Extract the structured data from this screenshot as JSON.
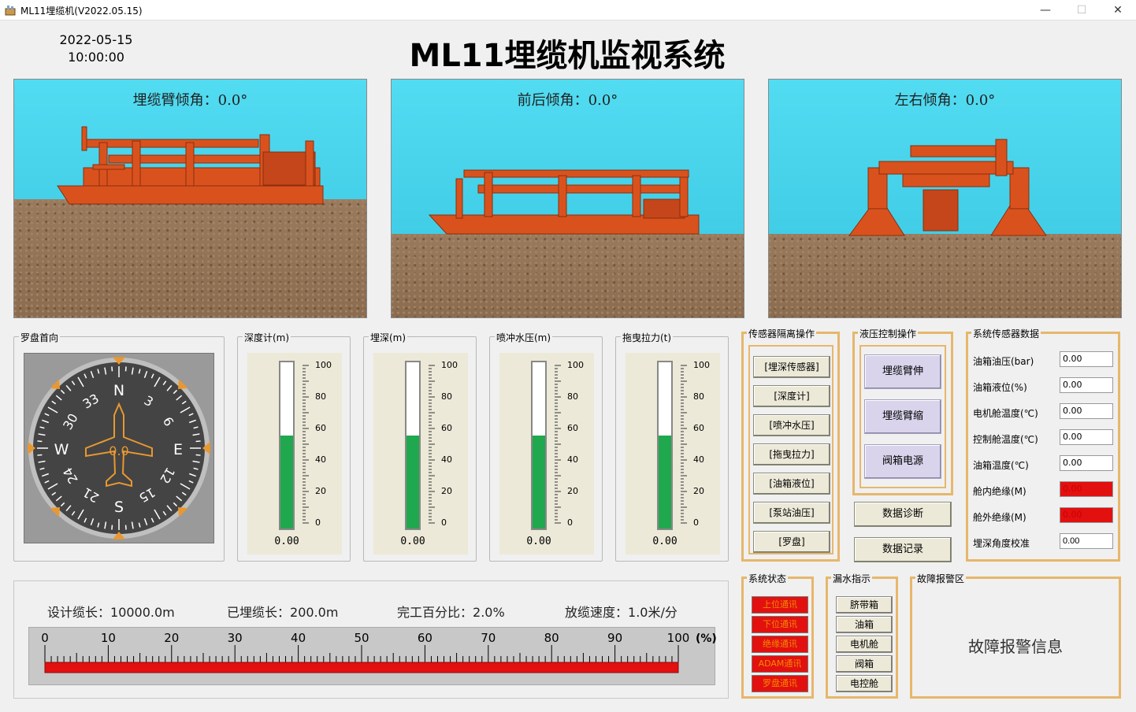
{
  "window": {
    "title": "ML11埋缆机(V2022.05.15)",
    "minimize": "—",
    "maximize": "☐",
    "close": "✕"
  },
  "header": {
    "date": "2022-05-15",
    "time": "10:00:00",
    "title": "ML11埋缆机监视系统"
  },
  "scenes": [
    {
      "label": "埋缆臂倾角：0.0°"
    },
    {
      "label": "前后倾角：0.0°"
    },
    {
      "label": "左右倾角：0.0°"
    }
  ],
  "compass": {
    "title": "罗盘首向",
    "heading_value": "0.0",
    "cardinals": [
      "N",
      "E",
      "S",
      "W"
    ],
    "numbers": [
      "3",
      "6",
      "12",
      "15",
      "21",
      "24",
      "30",
      "33"
    ]
  },
  "gauges": [
    {
      "title": "深度计(m)",
      "value": "0.00",
      "level_pct": 56
    },
    {
      "title": "埋深(m)",
      "value": "0.00",
      "level_pct": 56
    },
    {
      "title": "喷冲水压(m)",
      "value": "0.00",
      "level_pct": 56
    },
    {
      "title": "拖曳拉力(t)",
      "value": "0.00",
      "level_pct": 56
    }
  ],
  "gauge_scale": [
    "100",
    "80",
    "60",
    "40",
    "20",
    "0"
  ],
  "sensor_isolation": {
    "title": "传感器隔离操作",
    "buttons": [
      "[埋深传感器]",
      "[深度计]",
      "[喷冲水压]",
      "[拖曳拉力]",
      "[油箱液位]",
      "[泵站油压]",
      "[罗盘]"
    ]
  },
  "hydraulic": {
    "title": "液压控制操作",
    "buttons": [
      "埋缆臂伸",
      "埋缆臂缩",
      "阀箱电源"
    ],
    "diagnose": "数据诊断",
    "record": "数据记录"
  },
  "system_sensors": {
    "title": "系统传感器数据",
    "rows": [
      {
        "label": "油箱油压(bar)",
        "value": "0.00",
        "alarm": false
      },
      {
        "label": "油箱液位(%)",
        "value": "0.00",
        "alarm": false
      },
      {
        "label": "电机舱温度(℃)",
        "value": "0.00",
        "alarm": false
      },
      {
        "label": "控制舱温度(℃)",
        "value": "0.00",
        "alarm": false
      },
      {
        "label": "油箱温度(℃)",
        "value": "0.00",
        "alarm": false
      },
      {
        "label": "舱内绝缘(M)",
        "value": "0.00",
        "alarm": true
      },
      {
        "label": "舱外绝缘(M)",
        "value": "0.00",
        "alarm": true
      },
      {
        "label": "埋深角度校准",
        "value": "0.00",
        "alarm": false
      }
    ]
  },
  "system_status": {
    "title": "系统状态",
    "items": [
      "上位通讯",
      "下位通讯",
      "绝缘通讯",
      "ADAM通讯",
      "罗盘通讯"
    ]
  },
  "leak": {
    "title": "漏水指示",
    "items": [
      "脐带箱",
      "油箱",
      "电机舱",
      "阀箱",
      "电控舱"
    ]
  },
  "fault": {
    "title": "故障报警区",
    "message": "故障报警信息"
  },
  "progress": {
    "design_label": "设计缆长：",
    "design_value": "10000.0m",
    "laid_label": "已埋缆长：",
    "laid_value": "200.0m",
    "pct_label": "完工百分比：",
    "pct_value": "2.0%",
    "speed_label": "放缆速度：",
    "speed_value": "1.0米/分",
    "ruler_labels": [
      "0",
      "10",
      "20",
      "30",
      "40",
      "50",
      "60",
      "70",
      "80",
      "90",
      "100"
    ],
    "unit": "(%)"
  },
  "colors": {
    "water": "#4dd6ee",
    "ground": "#8c6c4f",
    "machine": "#d9521e",
    "gauge_fill": "#1fa84e",
    "alarm_red": "#e31010",
    "frame_orange": "#e7b76b",
    "hyd_button": "#d9d4ec"
  }
}
